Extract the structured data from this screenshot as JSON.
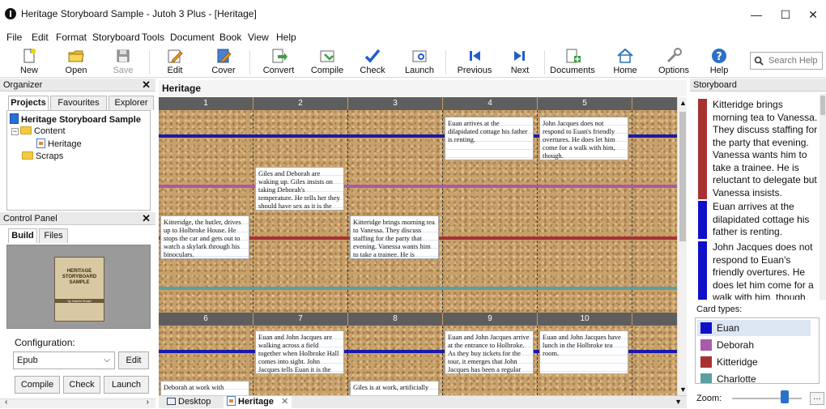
{
  "window": {
    "title": "Heritage Storyboard Sample - Jutoh 3 Plus - [Heritage]"
  },
  "menu": [
    "File",
    "Edit",
    "Format",
    "Storyboard",
    "Tools",
    "Document",
    "Book",
    "View",
    "Help"
  ],
  "toolbar": {
    "items": [
      {
        "label": "New",
        "icon": "new-document-icon"
      },
      {
        "label": "Open",
        "icon": "open-folder-icon"
      },
      {
        "label": "Save",
        "icon": "save-icon"
      },
      {
        "label": "Edit",
        "icon": "edit-icon"
      },
      {
        "label": "Cover",
        "icon": "cover-icon"
      },
      {
        "label": "Convert",
        "icon": "convert-icon"
      },
      {
        "label": "Compile",
        "icon": "compile-icon"
      },
      {
        "label": "Check",
        "icon": "check-icon"
      },
      {
        "label": "Launch",
        "icon": "launch-icon"
      },
      {
        "label": "Previous",
        "icon": "previous-icon"
      },
      {
        "label": "Next",
        "icon": "next-icon"
      },
      {
        "label": "Documents",
        "icon": "documents-icon"
      },
      {
        "label": "Home",
        "icon": "home-icon"
      },
      {
        "label": "Options",
        "icon": "options-icon"
      },
      {
        "label": "Help",
        "icon": "help-icon"
      }
    ],
    "search_placeholder": "Search Help"
  },
  "organizer": {
    "title": "Organizer",
    "tabs": [
      "Projects",
      "Favourites",
      "Explorer"
    ],
    "tree": {
      "project": "Heritage Storyboard Sample",
      "content": "Content",
      "heritage": "Heritage",
      "scraps": "Scraps"
    }
  },
  "control_panel": {
    "title": "Control Panel",
    "tabs": [
      "Build",
      "Files"
    ],
    "cover": {
      "title": "HERITAGE STORYBOARD SAMPLE",
      "author": "by Harriet Smart"
    },
    "configuration_label": "Configuration:",
    "configuration_value": "Epub",
    "edit_label": "Edit",
    "buttons": [
      "Compile",
      "Check",
      "Launch"
    ]
  },
  "storyboard": {
    "title": "Heritage",
    "columns_top": [
      "1",
      "2",
      "3",
      "4",
      "5"
    ],
    "columns_bottom": [
      "6",
      "7",
      "8",
      "9",
      "10"
    ],
    "cards": {
      "c1": "Kitteridge, the butler, drives up to Holbroke House. He stops the car and gets out to watch a skylark through his binoculars.",
      "c2": "Giles and Deborah are waking up.  Giles insists on taking Deborah's temperature. He tells her they should have sex as it is the",
      "c3": "Kitteridge brings morning tea to Vanessa. They discuss staffing for the party that evening. Vanessa wants him to take a trainee. He is",
      "c4": "Euan arrives at the dilapidated cottage his father is renting.",
      "c5": "John Jacques does not respond to Euan's friendly overtures. He does let him come for a walk with him, though.",
      "c6": "Deborah at work with",
      "c7": "Euan and John Jacques are walking across a field together when Holbroke Hall comes into sight. John Jacques tells Euan it is the",
      "c8": "Giles is at work, artificially",
      "c9": "Euan and John Jacques arrive at the entrance to Holbroke. As they buy tickets for the tour, it emerges that John Jacques has been a regular",
      "c10": "Euan and John Jacques have lunch in the Holbroke tea room."
    },
    "lane_colors": {
      "euan": "#1a1aa8",
      "deborah": "#a85ba8",
      "kitteridge": "#a83232",
      "charlotte": "#5aa0a0"
    }
  },
  "doc_tabs": [
    "Desktop",
    "Heritage"
  ],
  "right_panel": {
    "title": "Storyboard",
    "items": [
      {
        "text": "Kitteridge brings morning tea to Vanessa. They discuss staffing for the party that evening. Vanessa wants him to take a trainee. He is reluctant to delegate but Vanessa insists.",
        "color": "#a83232"
      },
      {
        "text": "Euan arrives at the dilapidated cottage his father is renting.",
        "color": "#1010c8"
      },
      {
        "text": "John Jacques does not respond to Euan's friendly overtures. He does let him come for a walk with him, though.",
        "color": "#1010c8"
      }
    ],
    "card_types_label": "Card types:",
    "card_types": [
      {
        "name": "Euan",
        "color": "#1010c8"
      },
      {
        "name": "Deborah",
        "color": "#a85ba8"
      },
      {
        "name": "Kitteridge",
        "color": "#a83232"
      },
      {
        "name": "Charlotte",
        "color": "#5aa0a0"
      }
    ],
    "zoom_label": "Zoom:"
  }
}
